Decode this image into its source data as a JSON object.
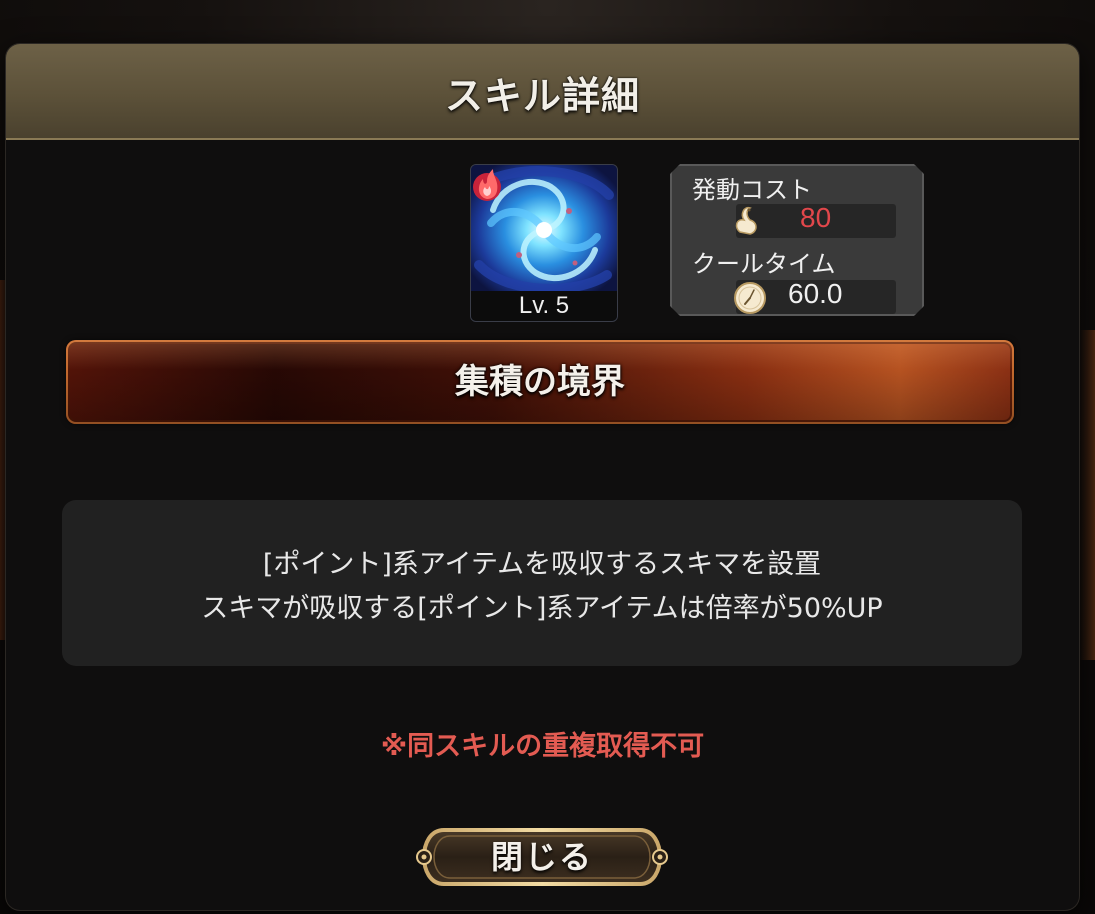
{
  "dialog": {
    "title": "スキル詳細"
  },
  "skill": {
    "icon": "blue-vortex-skill-icon",
    "element_icon": "fire-icon",
    "level_text": "Lv. 5",
    "name": "集積の境界"
  },
  "stats": {
    "cost_label": "発動コスト",
    "cost_icon": "swan-icon",
    "cost_value": "80",
    "cooltime_label": "クールタイム",
    "cooltime_icon": "clock-icon",
    "cooltime_value": "60.0"
  },
  "description": {
    "line1": "[ポイント]系アイテムを吸収するスキマを設置",
    "line2": "スキマが吸収する[ポイント]系アイテムは倍率が50%UP"
  },
  "warning": "※同スキルの重複取得不可",
  "buttons": {
    "close_label": "閉じる"
  },
  "colors": {
    "header": "#5c5139",
    "cost_value": "#e2474b",
    "warning": "#e35b52",
    "banner_edge": "#c46a2e"
  }
}
